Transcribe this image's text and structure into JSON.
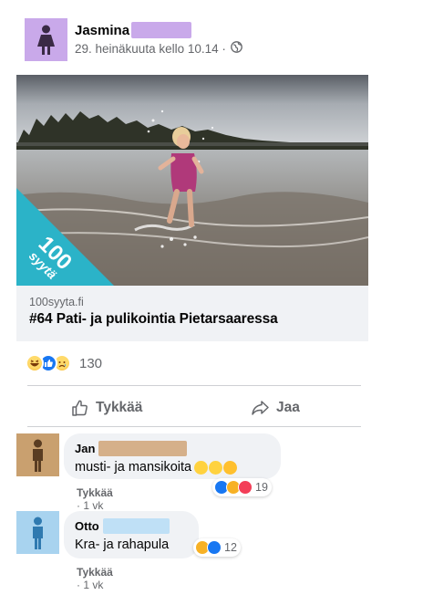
{
  "post": {
    "author_name": "Jasmina",
    "author_redacted_color": "#c9a9ea",
    "avatar_bg": "#c9a9ea",
    "date": "29. heinäkuuta kello 10.14 ·",
    "privacy_icon": "globe-icon"
  },
  "link": {
    "domain": "100syyta.fi",
    "title": "#64 Pati- ja pulikointia Pietarsaaressa",
    "badge_text": "syytä",
    "badge_number": "100",
    "badge_color": "#2bb3c8"
  },
  "reactions": {
    "icons": [
      "haha-icon",
      "like-icon",
      "sad-icon"
    ],
    "count": "130"
  },
  "actions": {
    "like_label": "Tykkää",
    "share_label": "Jaa"
  },
  "comments": [
    {
      "author": "Jan",
      "avatar_bg": "#c9a06f",
      "redact_color": "#d5b08a",
      "text": "musti- ja mansikoita",
      "reaction_icons": [
        "like-icon",
        "haha-icon",
        "love-icon"
      ],
      "reaction_count": "19",
      "like_label": "Tykkää",
      "time": "1 vk"
    },
    {
      "author": "Otto",
      "avatar_bg": "#a8d3ef",
      "redact_color": "#bfe0f6",
      "text": "Kra- ja rahapula",
      "reaction_icons": [
        "haha-icon",
        "like-icon"
      ],
      "reaction_count": "12",
      "like_label": "Tykkää",
      "time": "1 vk"
    }
  ]
}
